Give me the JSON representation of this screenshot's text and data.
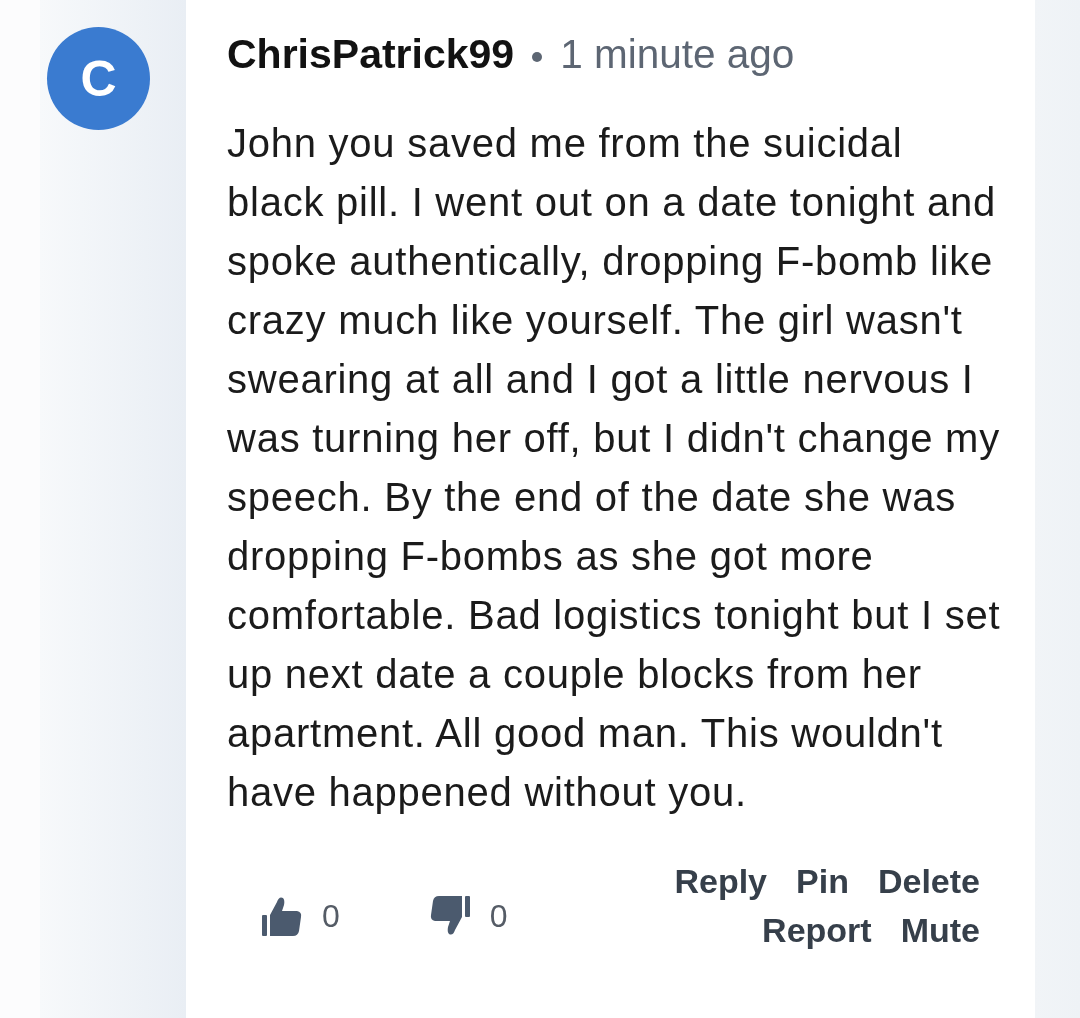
{
  "comment": {
    "avatar_letter": "C",
    "author": "ChrisPatrick99",
    "time": "1 minute ago",
    "body": "John you saved me from the suicidal black pill. I went out on a date tonight and spoke authentically, dropping F-bomb like crazy much like yourself. The girl wasn't swearing at all and I got a little nervous I was turning her off, but I didn't change my speech. By the end of the date she was dropping F-bombs as she got more comfortable. Bad logistics tonight but I set up next date a couple blocks from her apartment. All good man. This wouldn't have happened without you.",
    "votes": [
      {
        "kind": "up",
        "count": "0"
      },
      {
        "kind": "down",
        "count": "0"
      }
    ],
    "action_rows": [
      [
        "Reply",
        "Pin",
        "Delete"
      ],
      [
        "Report",
        "Mute"
      ]
    ]
  }
}
